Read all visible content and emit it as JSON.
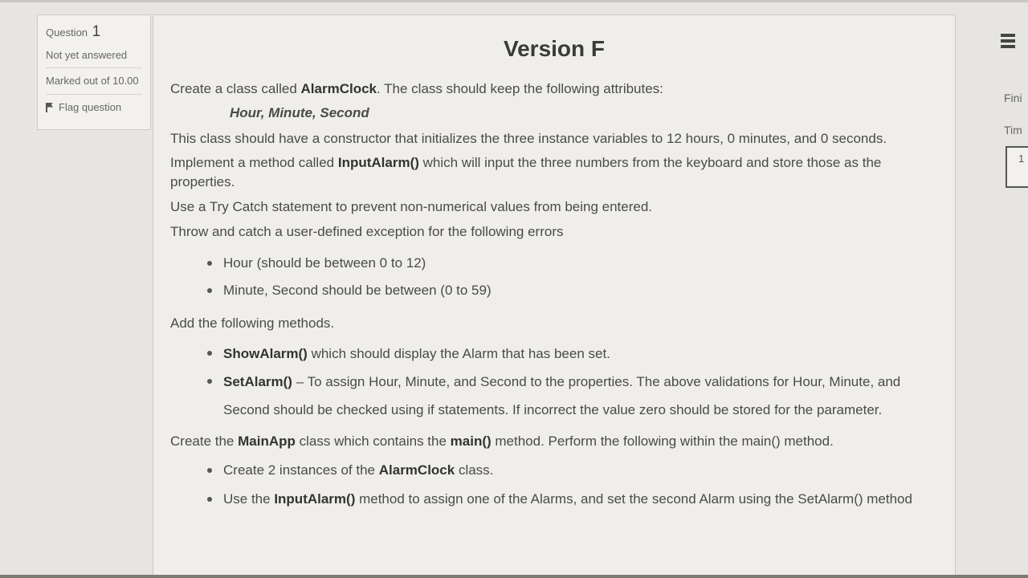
{
  "question_info": {
    "question_label": "Question",
    "question_number": "1",
    "state": "Not yet answered",
    "grade": "Marked out of 10.00",
    "flag_label": "Flag question"
  },
  "content": {
    "title": "Version F",
    "p1_pre": "Create a class called ",
    "p1_kw": "AlarmClock",
    "p1_post": ". The class should keep the following attributes:",
    "attributes": "Hour, Minute, Second",
    "p2": "This class should have a constructor that initializes the three instance variables to 12 hours, 0 minutes, and 0 seconds.",
    "p3_pre": "Implement a method called ",
    "p3_kw": "InputAlarm()",
    "p3_post": " which will input the three numbers from the keyboard and store those as the properties.",
    "p4": "Use a Try Catch statement to prevent non-numerical values from being entered.",
    "p5": "Throw and catch a user-defined exception for the following errors",
    "errors": [
      "Hour (should be between 0 to 12)",
      "Minute, Second should be between (0 to 59)"
    ],
    "p6": "Add the following methods.",
    "methods": [
      {
        "kw": "ShowAlarm()",
        "text": " which should display the Alarm that has been set."
      },
      {
        "kw": "SetAlarm()",
        "text": " – To assign Hour, Minute, and Second to the properties.  The above validations for Hour, Minute, and Second should be checked using if statements.  If incorrect the value zero should be stored for the parameter."
      }
    ],
    "p7_pre": "Create the ",
    "p7_kw1": "MainApp",
    "p7_mid": " class which contains the ",
    "p7_kw2": "main()",
    "p7_post": " method. Perform the following within the main() method.",
    "main_items": [
      {
        "pre": "Create 2 instances of the ",
        "kw": "AlarmClock",
        "post": " class."
      },
      {
        "pre": "Use the ",
        "kw": "InputAlarm()",
        "post": " method to assign one of the Alarms, and set the second Alarm using the SetAlarm() method"
      }
    ]
  },
  "sidebar_right": {
    "finish_label": "Fini",
    "time_label": "Tim",
    "timer_value": "1"
  }
}
